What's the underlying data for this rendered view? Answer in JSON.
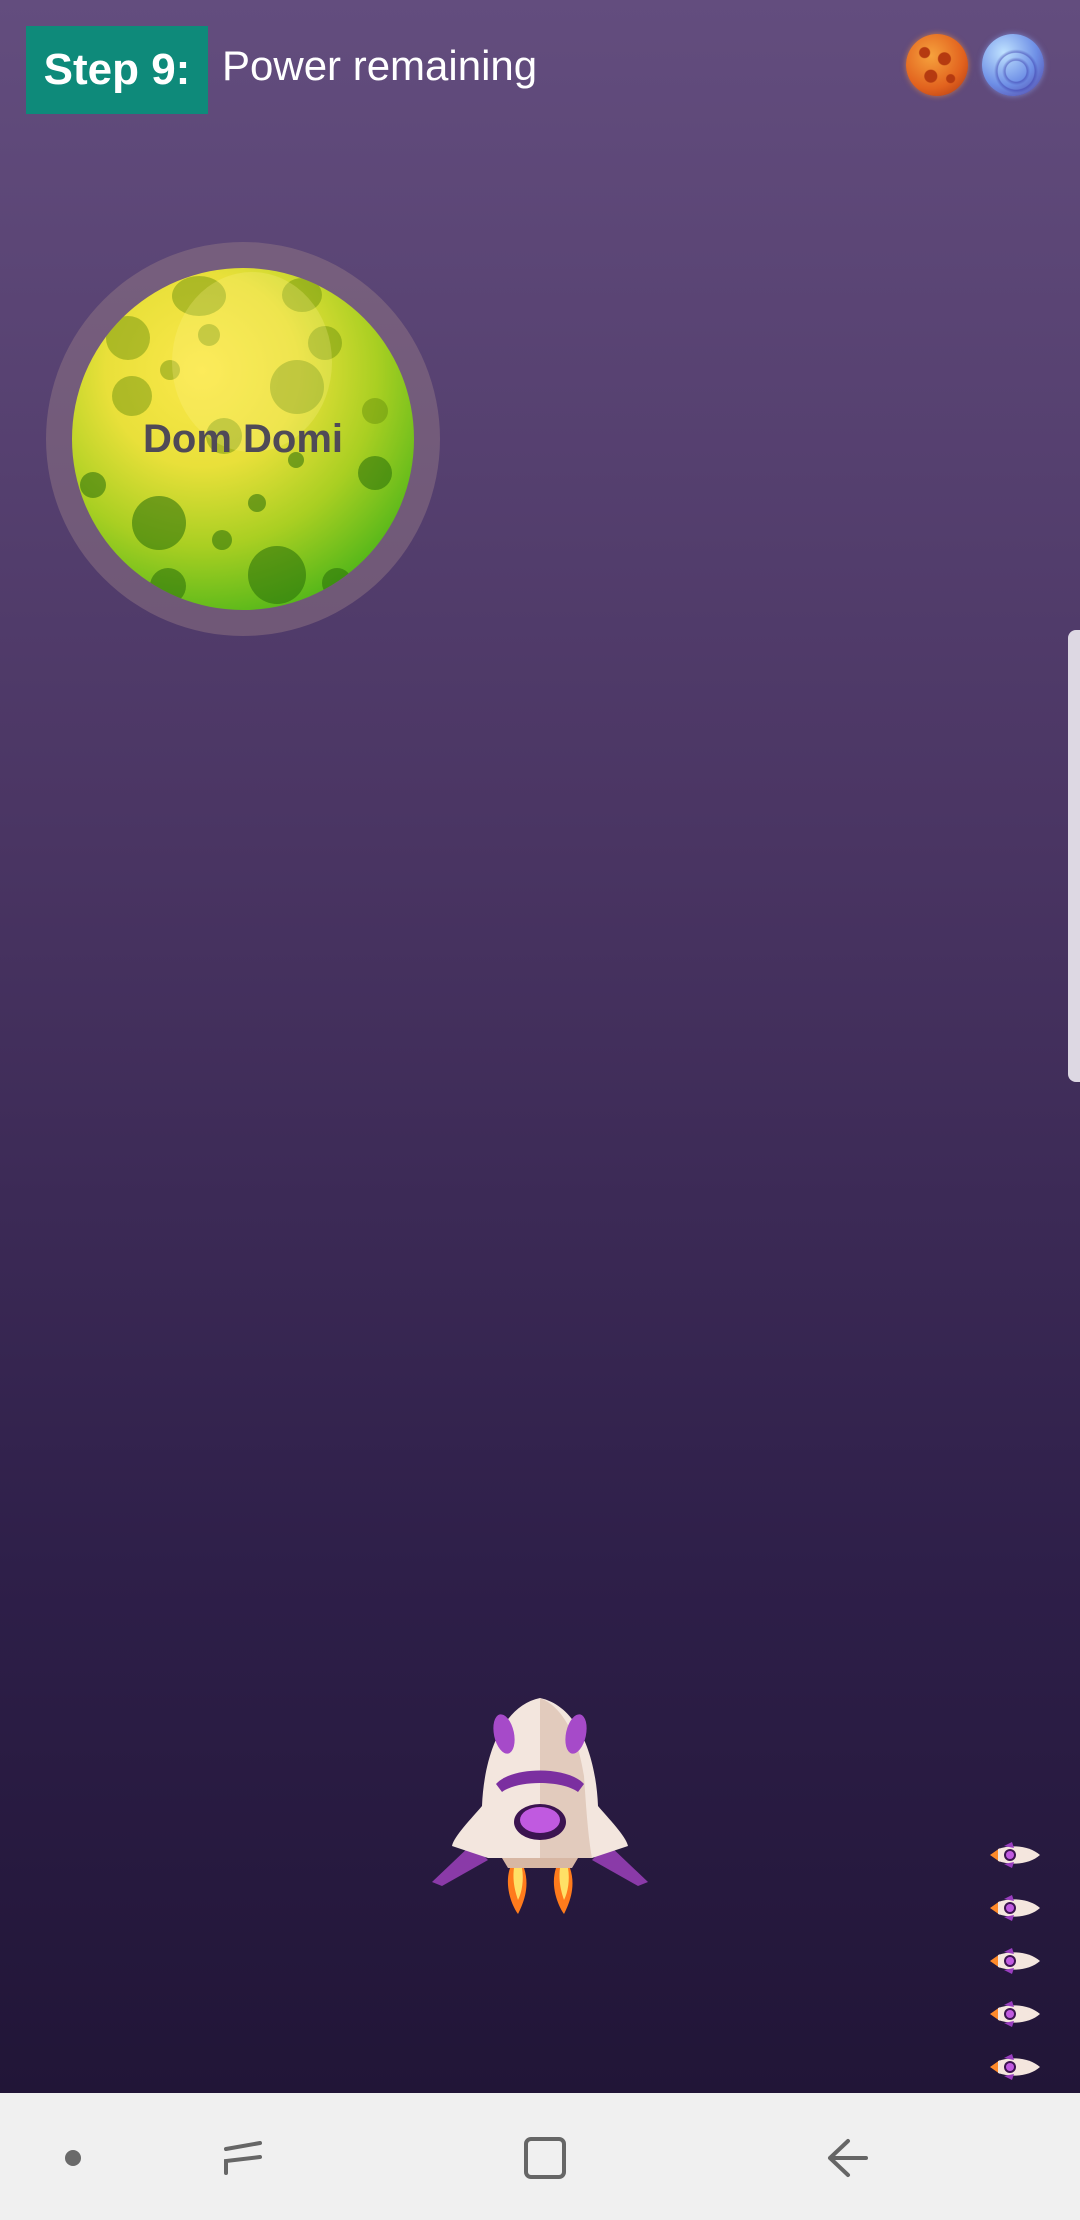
{
  "header": {
    "step_label": "Step 9:",
    "status_text": "Power remaining",
    "planet_icons": [
      "orange-planet-icon",
      "blue-planet-icon"
    ]
  },
  "target_planet": {
    "name": "Dom Domi",
    "color": "#7cc41e"
  },
  "player": {
    "ship_icon": "rocket-ship-icon",
    "lives_remaining": 5
  },
  "colors": {
    "step_badge": "#0e8a7a",
    "background_top": "#634d7e",
    "background_bottom": "#211537",
    "nav_bar": "#f0f0f0"
  },
  "nav_bar": {
    "buttons": [
      "dot-icon",
      "recent-apps-icon",
      "home-icon",
      "back-icon"
    ]
  }
}
